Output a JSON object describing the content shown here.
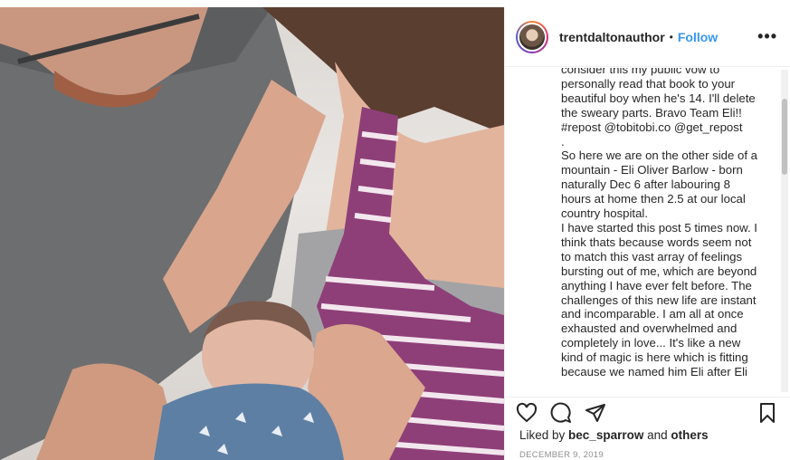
{
  "post": {
    "username": "trentdaltonauthor",
    "separator": "•",
    "follow_label": "Follow",
    "more_label": "•••",
    "caption_top": "consider this my public vow to\npersonally read that book to your\nbeautiful boy when he's 14. I'll delete\nthe sweary parts. Bravo Team Eli!!\n#repost @tobitobi.co @get_repost\n.\nSo here we are on the other side of a\nmountain - Eli Oliver Barlow - born\nnaturally Dec 6 after labouring 8\nhours at home then 2.5 at our local\ncountry hospital.\nI have started this post 5 times now. I\nthink thats because words seem not\nto match this vast array of feelings\nbursting out of me, which are beyond\nanything I have ever felt before. The\nchallenges of this new life are instant\nand incomparable. I am all at once\nexhausted and overwhelmed and\ncompletely in love... It's like a new\nkind of magic is here which is fitting\nbecause we named him Eli after Eli",
    "liked_prefix": "Liked by ",
    "liked_user": "bec_sparrow",
    "liked_and": " and ",
    "liked_others": "others",
    "date": "DECEMBER 9, 2019"
  },
  "icons": {
    "avatar": "author-avatar",
    "like": "heart-icon",
    "comment": "comment-icon",
    "share": "share-icon",
    "save": "bookmark-icon"
  },
  "colors": {
    "follow": "#3897f0",
    "text": "#262626",
    "muted": "#8e8e8e"
  }
}
